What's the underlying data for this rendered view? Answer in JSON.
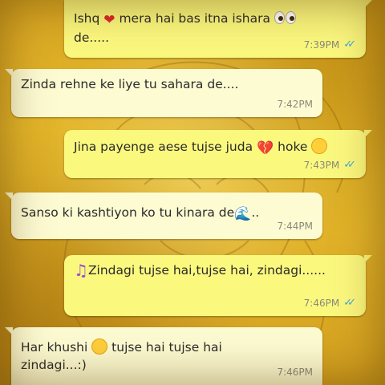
{
  "messages": [
    {
      "direction": "out",
      "parts": [
        "Ishq",
        "mera hai bas itna ishara",
        "de....."
      ],
      "time": "7:39PM",
      "read": true,
      "emojis": [
        "red-heart",
        "eyes"
      ]
    },
    {
      "direction": "in",
      "text": "Zinda rehne ke liye tu sahara de....",
      "time": "7:42PM"
    },
    {
      "direction": "out",
      "parts": [
        "Jina payenge aese tujse juda",
        "hoke"
      ],
      "time": "7:43PM",
      "read": true,
      "emojis": [
        "broken-heart",
        "persevering-face"
      ]
    },
    {
      "direction": "in",
      "parts": [
        "Sanso ki kashtiyon ko tu kinara de",
        ".."
      ],
      "time": "7:44PM",
      "emojis": [
        "water-wave"
      ]
    },
    {
      "direction": "out",
      "text": "Zindagi tujse hai,tujse hai, zindagi......",
      "time": "7:46PM",
      "read": true,
      "emojis": [
        "musical-notes"
      ]
    },
    {
      "direction": "in",
      "parts": [
        "Har khushi",
        "tujse hai tujse hai zindagi...:)"
      ],
      "time": "7:46PM",
      "emojis": [
        "relieved-face"
      ]
    }
  ],
  "colors": {
    "outgoing_bubble": "#fbf87e",
    "incoming_bubble": "#fdfbd2",
    "read_ticks": "#3fa8d8",
    "wallpaper": "#e0b028"
  },
  "glyphs": {
    "heart": "❤",
    "broken_heart": "💔",
    "notes": "♫",
    "wave": "🌊",
    "ticks": "✓✓"
  }
}
